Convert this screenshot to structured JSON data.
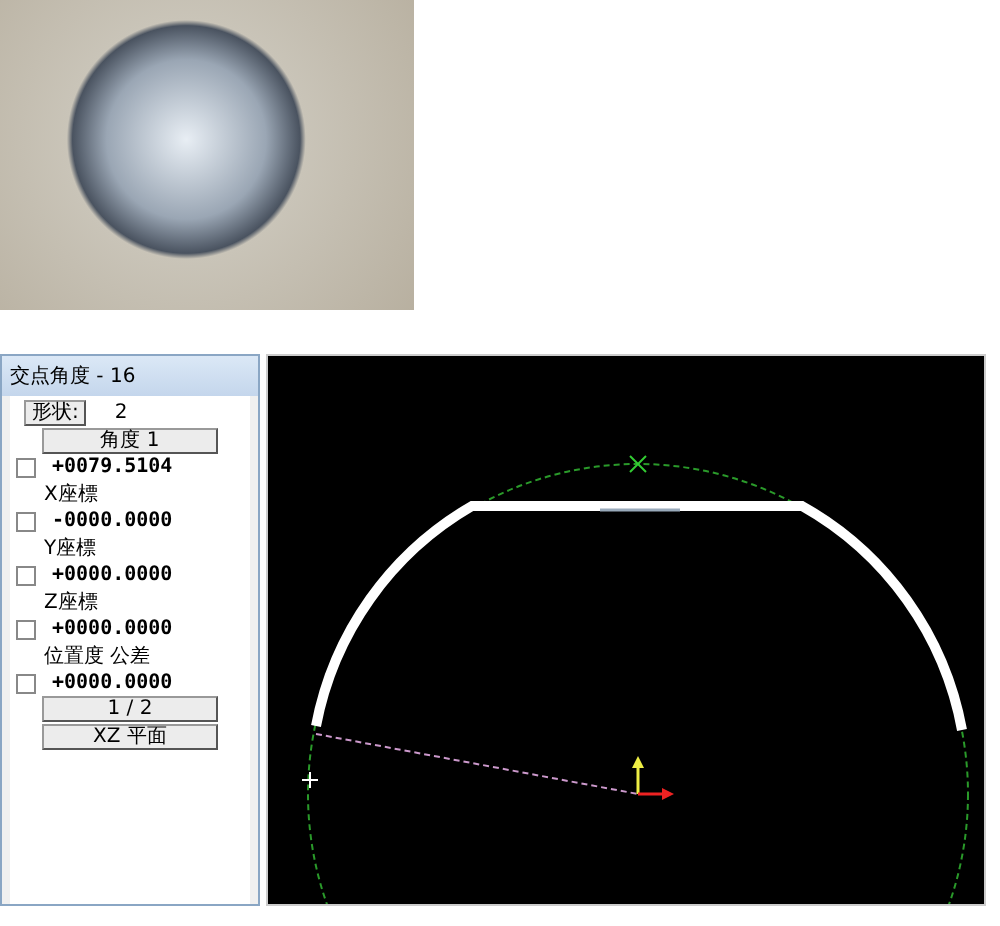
{
  "panel": {
    "title": "交点角度 - 16",
    "rows": [
      {
        "kind": "shape",
        "button": "形状:",
        "value": "2"
      },
      {
        "kind": "button",
        "label": "角度 1"
      },
      {
        "kind": "value",
        "value": "+0079.5104",
        "checked": false
      },
      {
        "kind": "label",
        "label": "X座標"
      },
      {
        "kind": "value",
        "value": "-0000.0000",
        "checked": false
      },
      {
        "kind": "label",
        "label": "Y座標"
      },
      {
        "kind": "value",
        "value": "+0000.0000",
        "checked": false
      },
      {
        "kind": "label",
        "label": "Z座標"
      },
      {
        "kind": "value",
        "value": "+0000.0000",
        "checked": false
      },
      {
        "kind": "label",
        "label": "位置度 公差"
      },
      {
        "kind": "value",
        "value": "+0000.0000",
        "checked": false
      },
      {
        "kind": "button",
        "label": "1 / 2"
      },
      {
        "kind": "button",
        "label": "XZ 平面"
      }
    ]
  }
}
